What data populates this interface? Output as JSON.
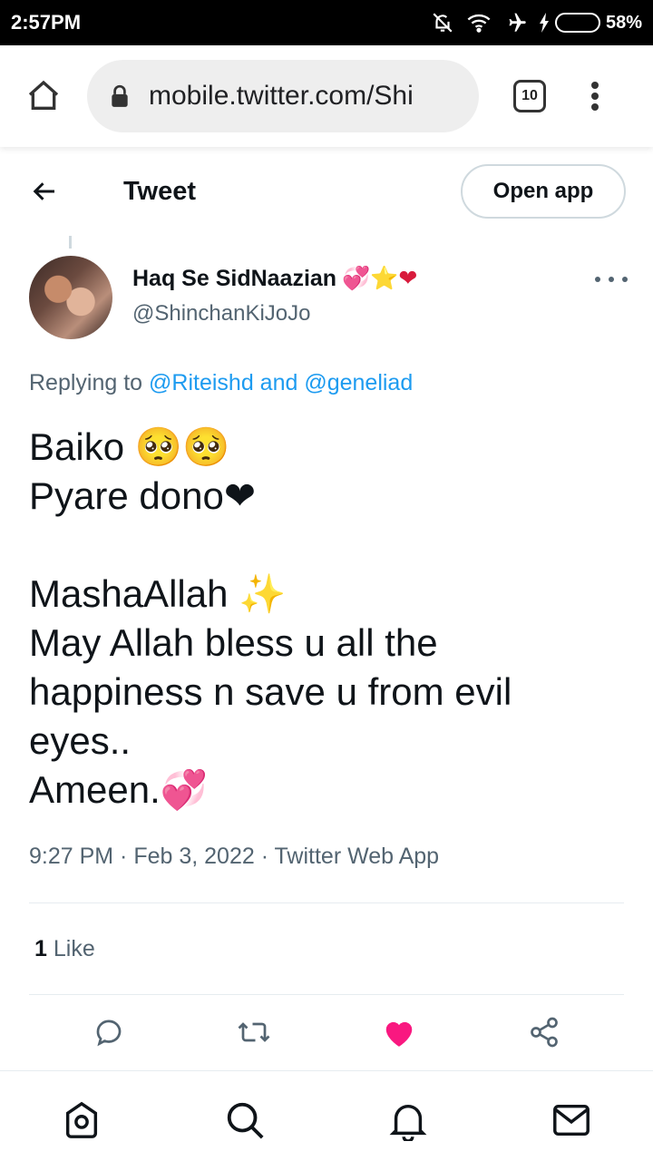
{
  "status_bar": {
    "time": "2:57PM",
    "battery_percent": "58%",
    "battery_level": 0.58,
    "icons": [
      "notifications-off-icon",
      "wifi-icon",
      "airplane-icon",
      "charging-icon",
      "battery-icon"
    ]
  },
  "browser": {
    "url": "mobile.twitter.com/Shi",
    "tab_count": "10"
  },
  "header": {
    "title": "Tweet",
    "open_app_label": "Open app"
  },
  "tweet": {
    "author": {
      "display_name": "Haq Se SidNaazian",
      "name_emojis": "💞⭐❤",
      "handle": "@ShinchanKiJoJo"
    },
    "replying_prefix": "Replying to",
    "replying_to": "@Riteishd and @geneliad",
    "lines": [
      "Baiko 🥺🥺",
      "Pyare dono❤",
      "",
      "MashaAllah ✨",
      "May Allah bless u all the",
      "happiness n save u from evil",
      "eyes..",
      "Ameen.💞"
    ],
    "timestamp": "9:27 PM · Feb 3, 2022 · Twitter Web App",
    "likes_count": "1",
    "likes_label": "Like"
  },
  "colors": {
    "text": "#0f1419",
    "secondary": "#536471",
    "link": "#1d9bf0",
    "like": "#f91880",
    "border": "#cfd9de"
  },
  "icons": {
    "actions": [
      "reply-icon",
      "retweet-icon",
      "like-icon",
      "share-icon"
    ],
    "nav": [
      "home-icon",
      "search-icon",
      "notifications-icon",
      "messages-icon"
    ]
  }
}
